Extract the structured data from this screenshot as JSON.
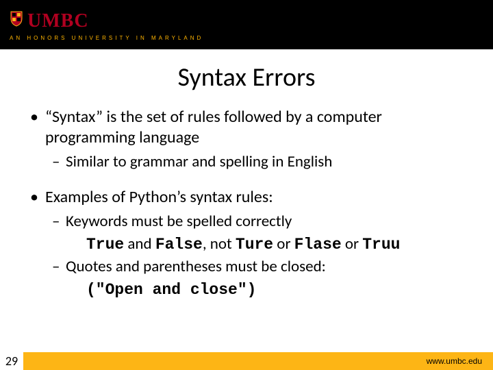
{
  "header": {
    "logo_text": "UMBC",
    "tagline": "AN HONORS UNIVERSITY IN MARYLAND"
  },
  "title": "Syntax Errors",
  "bullets": {
    "b1a": "“Syntax” is the set of rules followed by a computer programming language",
    "b1a_sub1": "Similar to grammar and spelling in English",
    "b1b": "Examples of Python’s syntax rules:",
    "b1b_sub1": "Keywords must be spelled correctly",
    "b1b_sub1_line": {
      "code1": "True",
      "t1": " and ",
      "code2": "False",
      "t2": ", not ",
      "code3": "Ture",
      "t3": " or ",
      "code4": "Flase",
      "t4": " or ",
      "code5": "Truu"
    },
    "b1b_sub2": "Quotes and parentheses must be closed:",
    "b1b_sub2_code": "(\"Open and close\")"
  },
  "footer": {
    "page": "29",
    "url": "www.umbc.edu"
  }
}
